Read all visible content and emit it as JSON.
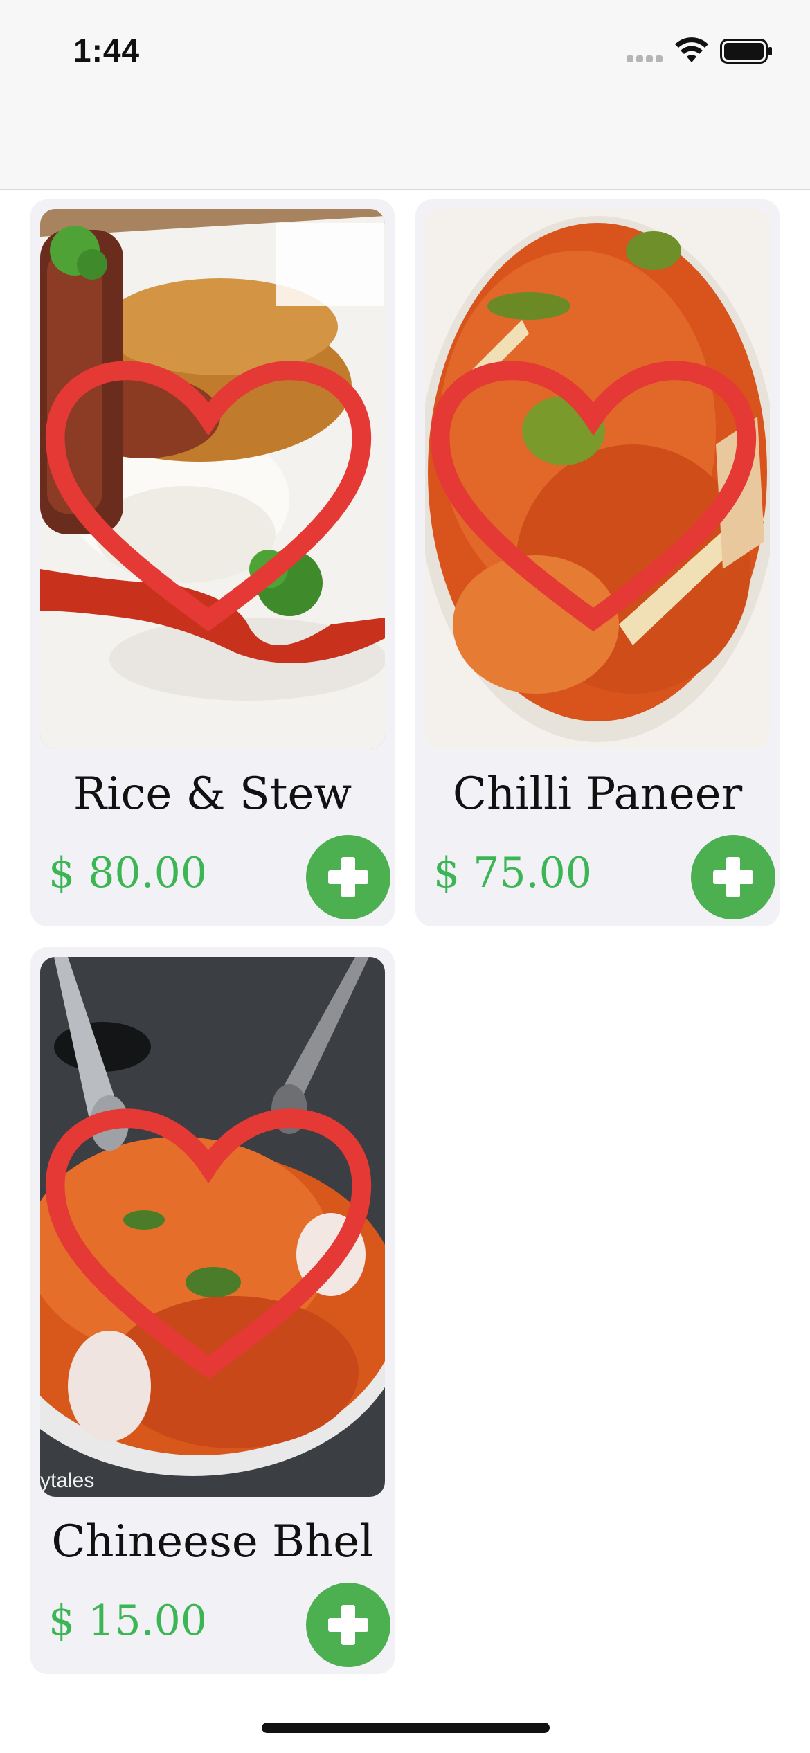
{
  "status_bar": {
    "time": "1:44"
  },
  "products": [
    {
      "name": "Rice & Stew",
      "price": "$ 80.00",
      "image": "rice-and-stew-photo"
    },
    {
      "name": "Chilli Paneer",
      "price": "$ 75.00",
      "image": "chilli-paneer-photo"
    },
    {
      "name": "Chineese Bhel",
      "price": "$ 15.00",
      "image": "chineese-bhel-photo",
      "watermark": "ytales"
    }
  ],
  "icons": {
    "favorite": "heart-outline-icon",
    "add": "plus-icon"
  },
  "colors": {
    "accent": "#4caf50",
    "price": "#3cb554",
    "heart": "#e53935",
    "card": "#f1f1f6"
  }
}
